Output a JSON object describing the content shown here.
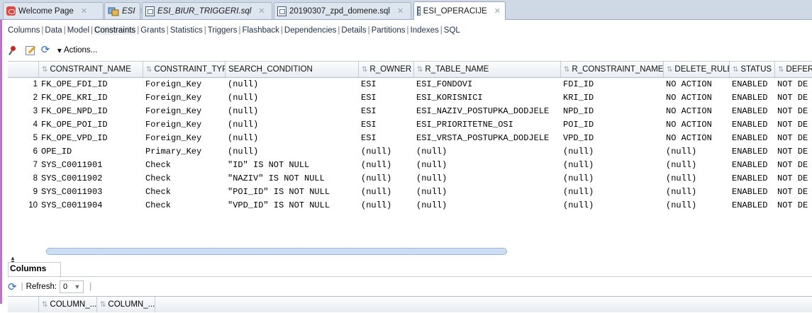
{
  "tabs": [
    {
      "label": "Welcome Page",
      "icon": "oracle-icon",
      "italic": false,
      "active": false
    },
    {
      "label": "ESI",
      "icon": "package-icon",
      "italic": true,
      "active": false
    },
    {
      "label": "ESI_BIUR_TRIGGERI.sql",
      "icon": "sql-file-icon",
      "italic": true,
      "active": false
    },
    {
      "label": "20190307_zpd_domene.sql",
      "icon": "sql-file-icon",
      "italic": false,
      "active": false
    },
    {
      "label": "ESI_OPERACIJE",
      "icon": "table-icon",
      "italic": false,
      "active": true
    }
  ],
  "subtabs": [
    "Columns",
    "Data",
    "Model",
    "Constraints",
    "Grants",
    "Statistics",
    "Triggers",
    "Flashback",
    "Dependencies",
    "Details",
    "Partitions",
    "Indexes",
    "SQL"
  ],
  "active_subtab": "Constraints",
  "toolbar": {
    "actions_label": "Actions..."
  },
  "grid": {
    "columns": [
      "CONSTRAINT_NAME",
      "CONSTRAINT_TYPE",
      "SEARCH_CONDITION",
      "R_OWNER",
      "R_TABLE_NAME",
      "R_CONSTRAINT_NAME",
      "DELETE_RULE",
      "STATUS",
      "DEFER"
    ],
    "rows": [
      [
        "1",
        "FK_OPE_FDI_ID",
        "Foreign_Key",
        "(null)",
        "ESI",
        "ESI_FONDOVI",
        "FDI_ID",
        "NO ACTION",
        "ENABLED",
        "NOT DE"
      ],
      [
        "2",
        "FK_OPE_KRI_ID",
        "Foreign_Key",
        "(null)",
        "ESI",
        "ESI_KORISNICI",
        "KRI_ID",
        "NO ACTION",
        "ENABLED",
        "NOT DE"
      ],
      [
        "3",
        "FK_OPE_NPD_ID",
        "Foreign_Key",
        "(null)",
        "ESI",
        "ESI_NAZIV_POSTUPKA_DODJELE",
        "NPD_ID",
        "NO ACTION",
        "ENABLED",
        "NOT DE"
      ],
      [
        "4",
        "FK_OPE_POI_ID",
        "Foreign_Key",
        "(null)",
        "ESI",
        "ESI_PRIORITETNE_OSI",
        "POI_ID",
        "NO ACTION",
        "ENABLED",
        "NOT DE"
      ],
      [
        "5",
        "FK_OPE_VPD_ID",
        "Foreign_Key",
        "(null)",
        "ESI",
        "ESI_VRSTA_POSTUPKA_DODJELE",
        "VPD_ID",
        "NO ACTION",
        "ENABLED",
        "NOT DE"
      ],
      [
        "6",
        "OPE_ID",
        "Primary_Key",
        "(null)",
        "(null)",
        "(null)",
        "(null)",
        "(null)",
        "ENABLED",
        "NOT DE"
      ],
      [
        "7",
        "SYS_C0011901",
        "Check",
        "\"ID\" IS NOT NULL",
        "(null)",
        "(null)",
        "(null)",
        "(null)",
        "ENABLED",
        "NOT DE"
      ],
      [
        "8",
        "SYS_C0011902",
        "Check",
        "\"NAZIV\" IS NOT NULL",
        "(null)",
        "(null)",
        "(null)",
        "(null)",
        "ENABLED",
        "NOT DE"
      ],
      [
        "9",
        "SYS_C0011903",
        "Check",
        "\"POI_ID\" IS NOT NULL",
        "(null)",
        "(null)",
        "(null)",
        "(null)",
        "ENABLED",
        "NOT DE"
      ],
      [
        "10",
        "SYS_C0011904",
        "Check",
        "\"VPD_ID\" IS NOT NULL",
        "(null)",
        "(null)",
        "(null)",
        "(null)",
        "ENABLED",
        "NOT DE"
      ]
    ]
  },
  "bottom_panel": {
    "title": "Columns",
    "refresh_label": "Refresh:",
    "refresh_value": "0",
    "columns": [
      "COLUMN_...",
      "COLUMN_..."
    ]
  }
}
